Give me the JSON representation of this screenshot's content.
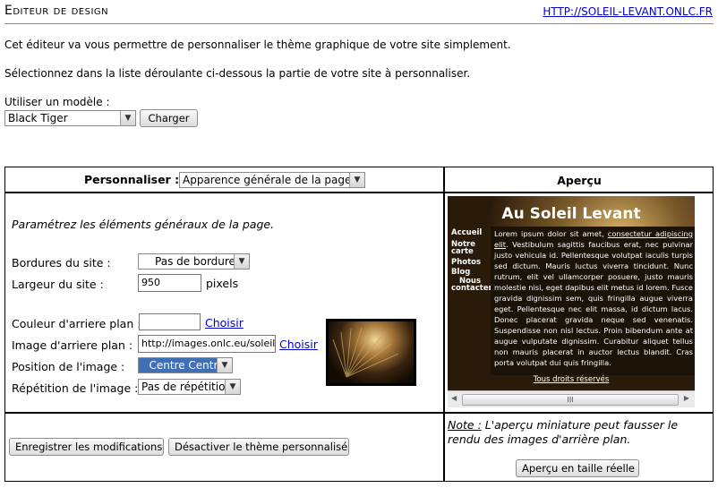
{
  "header": {
    "title": "Editeur de design",
    "site_link": "HTTP://SOLEIL-LEVANT.ONLC.FR"
  },
  "intro": {
    "line1": "Cet éditeur va vous permettre de personnaliser le thème graphique de votre site simplement.",
    "line2": "Sélectionnez dans la liste déroulante ci-dessous la partie de votre site à personnaliser."
  },
  "model": {
    "label": "Utiliser un modèle :",
    "selected": "Black Tiger",
    "load_button": "Charger"
  },
  "panel": {
    "customize_label": "Personnaliser :",
    "customize_selected": "Apparence générale de la page",
    "preview_header": "Aperçu",
    "instruction": "Paramétrez les éléments généraux de la page.",
    "border_label": "Bordures du site :",
    "border_selected": "Pas de bordure",
    "width_label": "Largeur du site :",
    "width_value": "950",
    "width_unit": "pixels",
    "bg_color_label": "Couleur d'arriere plan :",
    "bg_color_value": "",
    "bg_color_choose": "Choisir",
    "bg_image_label": "Image d'arriere plan :",
    "bg_image_value": "http://images.onlc.eu/soleil-",
    "bg_image_choose": "Choisir",
    "position_label": "Position de l'image :",
    "position_selected": "Centre Centre",
    "repeat_label": "Répétition de l'image :",
    "repeat_selected": "Pas de répétition",
    "save_button": "Enregistrer les modifications",
    "disable_button": "Désactiver le thème personnalisé",
    "note_label": "Note :",
    "note_text": " L'aperçu miniature peut fausser le rendu des images d'arrière plan.",
    "full_preview_button": "Aperçu en taille réelle"
  },
  "preview": {
    "site_title": "Au Soleil Levant",
    "nav": [
      "Accueil",
      "Notre carte",
      "Photos",
      "Blog",
      "Nous contacter"
    ],
    "text_start": "Lorem ipsum dolor sit amet, ",
    "text_link": "consectetur adipiscing elit",
    "text_rest": ". Vestibulum sagittis faucibus erat, nec pulvinar justo vehicula id. Pellentesque volutpat iaculis turpis sed dictum. Mauris luctus viverra tincidunt. Nunc rutrum, elit vel ullamcorper posuere, justo mauris molestie nisi, eget dapibus elit metus id lorem. Fusce gravida dignissim sem, quis fringilla augue viverra eget. Pellentesque nec elit massa, id dictum lacus. Donec placerat gravida neque sed venenatis. Suspendisse non nisl lectus. Proin bibendum ante at augue vulputate dignissim. Curabitur aliquet tellus non mauris placerat in auctor lectus blandit. Cras porta volutpat dui quis fringilla.",
    "footer": "Tous droits réservés",
    "scroll_thumb": "III"
  }
}
